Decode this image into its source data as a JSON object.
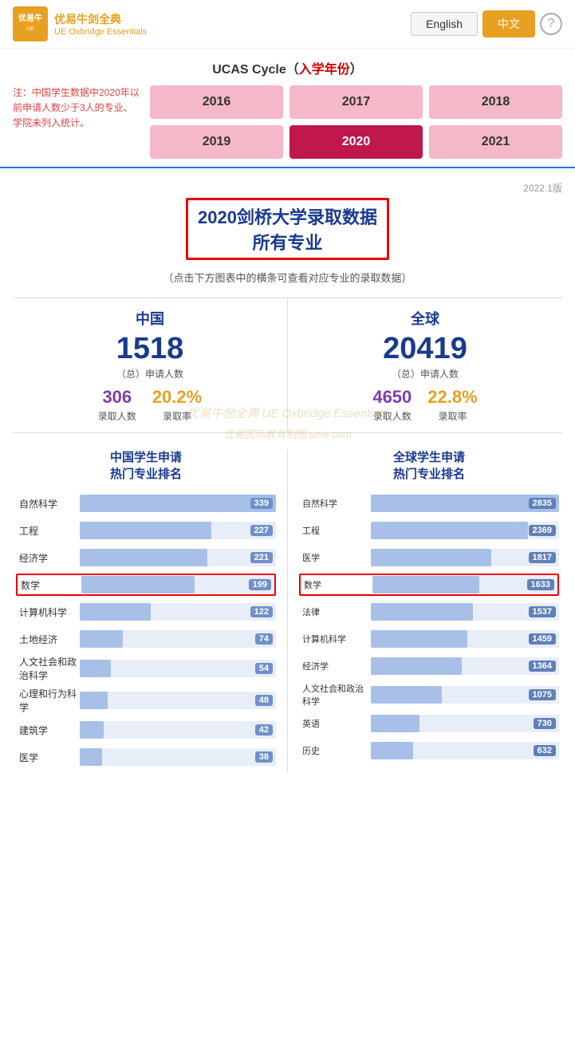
{
  "header": {
    "logo_cn": "优易牛剑全典",
    "logo_en": "UE Oxbridge Essentials",
    "lang_en": "English",
    "lang_zh": "中文",
    "help": "?"
  },
  "ucas": {
    "title_prefix": "UCAS Cycle (",
    "title_highlight": "入学年份",
    "title_suffix": ")",
    "note": "注：中国学生数据中2020年以前申请人数少于3人的专业、学院未列入统计。",
    "years": [
      {
        "label": "2016",
        "active": false
      },
      {
        "label": "2017",
        "active": false
      },
      {
        "label": "2018",
        "active": false
      },
      {
        "label": "2019",
        "active": false
      },
      {
        "label": "2020",
        "active": true
      },
      {
        "label": "2021",
        "active": false
      }
    ]
  },
  "main": {
    "version": "2022.1版",
    "title": "2020剑桥大学录取数据\n所有专业",
    "title_line1": "2020剑桥大学录取数据",
    "title_line2": "所有专业",
    "subtitle": "（点击下方图表中的横条可查看对应专业的录取数据）",
    "china": {
      "col_title": "中国",
      "total_applicants": "1518",
      "total_label": "（总）申请人数",
      "admitted": "306",
      "admit_rate": "20.2%",
      "admitted_label": "录取人数",
      "rate_label": "录取率"
    },
    "global": {
      "col_title": "全球",
      "total_applicants": "20419",
      "total_label": "（总）申请人数",
      "admitted": "4650",
      "admit_rate": "22.8%",
      "admitted_label": "录取人数",
      "rate_label": "录取率"
    },
    "watermark": "优易牛创全典 UE Oxbridge Essentials",
    "watermark2": "优易国际教育制图 ueie.com"
  },
  "rankings": {
    "china_title": "中国学生申请\n热门专业排名",
    "global_title": "全球学生申请\n热门专业排名",
    "china_max": 339,
    "global_max": 2835,
    "china_items": [
      {
        "label": "自然科学",
        "value": 339,
        "highlighted": false
      },
      {
        "label": "工程",
        "value": 227,
        "highlighted": false
      },
      {
        "label": "经济学",
        "value": 221,
        "highlighted": false
      },
      {
        "label": "数学",
        "value": 199,
        "highlighted": true
      },
      {
        "label": "计算机科学",
        "value": 122,
        "highlighted": false
      },
      {
        "label": "土地经济",
        "value": 74,
        "highlighted": false
      },
      {
        "label": "人文社会和政治科学",
        "value": 54,
        "highlighted": false
      },
      {
        "label": "心理和行为科学",
        "value": 48,
        "highlighted": false
      },
      {
        "label": "建筑学",
        "value": 42,
        "highlighted": false
      },
      {
        "label": "医学",
        "value": 38,
        "highlighted": false
      }
    ],
    "global_items": [
      {
        "label": "自然科学",
        "value": 2835,
        "highlighted": false
      },
      {
        "label": "工程",
        "value": 2369,
        "highlighted": false
      },
      {
        "label": "医学",
        "value": 1817,
        "highlighted": false
      },
      {
        "label": "数学",
        "value": 1633,
        "highlighted": true
      },
      {
        "label": "法律",
        "value": 1537,
        "highlighted": false
      },
      {
        "label": "计算机科学",
        "value": 1459,
        "highlighted": false
      },
      {
        "label": "经济学",
        "value": 1364,
        "highlighted": false
      },
      {
        "label": "人文社会和政治科学",
        "value": 1075,
        "highlighted": false
      },
      {
        "label": "英语",
        "value": 730,
        "highlighted": false
      },
      {
        "label": "历史",
        "value": 632,
        "highlighted": false
      }
    ]
  }
}
